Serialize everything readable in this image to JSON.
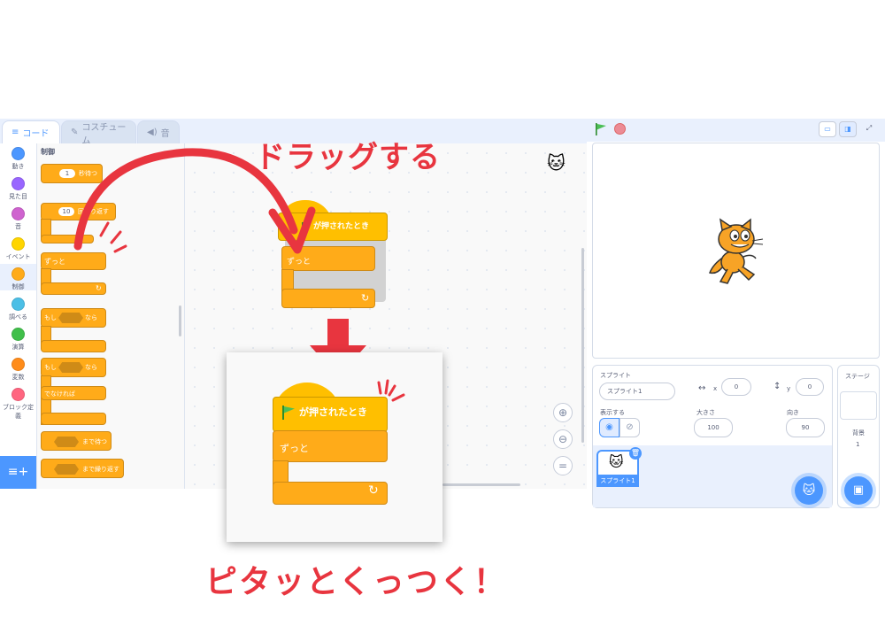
{
  "tabs": {
    "code": "コード",
    "costume": "コスチューム",
    "sound": "音"
  },
  "categories": [
    {
      "label": "動き",
      "color": "#4c97ff"
    },
    {
      "label": "見た目",
      "color": "#9966ff"
    },
    {
      "label": "音",
      "color": "#cf63cf"
    },
    {
      "label": "イベント",
      "color": "#ffd500"
    },
    {
      "label": "制御",
      "color": "#ffab19"
    },
    {
      "label": "調べる",
      "color": "#4cbfe6"
    },
    {
      "label": "演算",
      "color": "#40bf4a"
    },
    {
      "label": "変数",
      "color": "#ff8c1a"
    },
    {
      "label": "ブロック定義",
      "color": "#ff6680"
    }
  ],
  "palette": {
    "title": "制御",
    "wait_value": "1",
    "wait_suffix": "秒待つ",
    "repeat_value": "10",
    "repeat_suffix": "回繰り返す",
    "forever": "ずっと",
    "if_prefix": "もし",
    "if_suffix": "なら",
    "else": "でなければ",
    "wait_until": "まで待つ",
    "repeat_until": "まで繰り返す"
  },
  "workspace": {
    "hat_label": "が押されたとき",
    "forever_label": "ずっと"
  },
  "popup": {
    "hat_label": "が押されたとき",
    "forever_label": "ずっと"
  },
  "annotations": {
    "drag": "ドラッグする",
    "snap": "ピタッとくっつく！"
  },
  "sprite_info": {
    "section": "スプライト",
    "name": "スプライト1",
    "x_label": "x",
    "x_value": "0",
    "y_label": "y",
    "y_value": "0",
    "show_label": "表示する",
    "size_label": "大きさ",
    "size_value": "100",
    "direction_label": "向き",
    "direction_value": "90",
    "thumb_label": "スプライト1"
  },
  "stage_panel": {
    "title": "ステージ",
    "backdrop_label": "背景",
    "backdrop_count": "1"
  },
  "colors": {
    "control": "#ffab19",
    "control_dark": "#cf8b17",
    "event": "#ffbf00",
    "accent": "#4c97ff",
    "red": "#e8353f"
  },
  "icons": [
    "flag-icon",
    "stop-icon",
    "zoom-in-icon",
    "zoom-out-icon",
    "zoom-reset-icon",
    "cat-icon",
    "trash-icon",
    "rotate-arrow-icon"
  ]
}
